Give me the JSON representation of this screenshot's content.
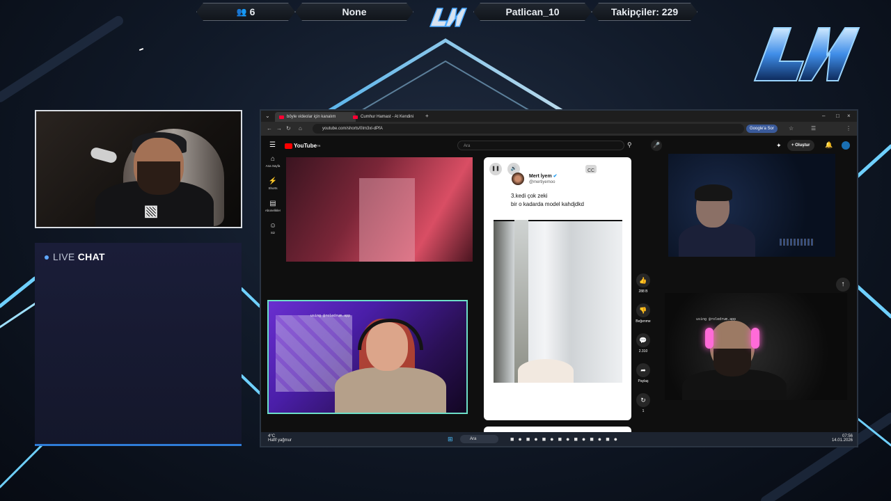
{
  "topbar": {
    "viewers": "6",
    "game": "None",
    "channel": "Patlican_10",
    "followers": "Takipçiler: 229"
  },
  "chat": {
    "live": "LIVE",
    "chat": "CHAT"
  },
  "browser": {
    "tabs": [
      {
        "title": "böyle videolar için kanalım"
      },
      {
        "title": "Cumhur Hamast - At Kendini"
      }
    ],
    "url": "youtube.com/shorts/0Im3xl-dPfA",
    "google_button": "Google'a Sor"
  },
  "youtube": {
    "logo": "YouTube",
    "logo_sup": "TR",
    "search_placeholder": "Ara",
    "create_label": "Oluştur",
    "sidebar": [
      {
        "label": "Ana Sayfa"
      },
      {
        "label": "Shorts"
      },
      {
        "label": "Abonelikler"
      },
      {
        "label": "Siz"
      }
    ],
    "short": {
      "author": "Mert İyem",
      "handle": "@mertiyemoo",
      "line1": "3.kedi çok zeki",
      "line2": "bir o kadarda model kahdjdkd"
    },
    "actions": [
      {
        "label": "288 B"
      },
      {
        "label": "Beğenme"
      },
      {
        "label": "2.310"
      },
      {
        "label": "Paylaş"
      },
      {
        "label": "1"
      }
    ]
  },
  "overlays": {
    "cam_tag_1": "using @roledrum.app",
    "cam_tag_2": "using @roledrum.app"
  },
  "taskbar": {
    "temp": "4°C",
    "weather": "Hafif yağmur",
    "search": "Ara",
    "time": "07:56",
    "date": "14.01.2026"
  }
}
